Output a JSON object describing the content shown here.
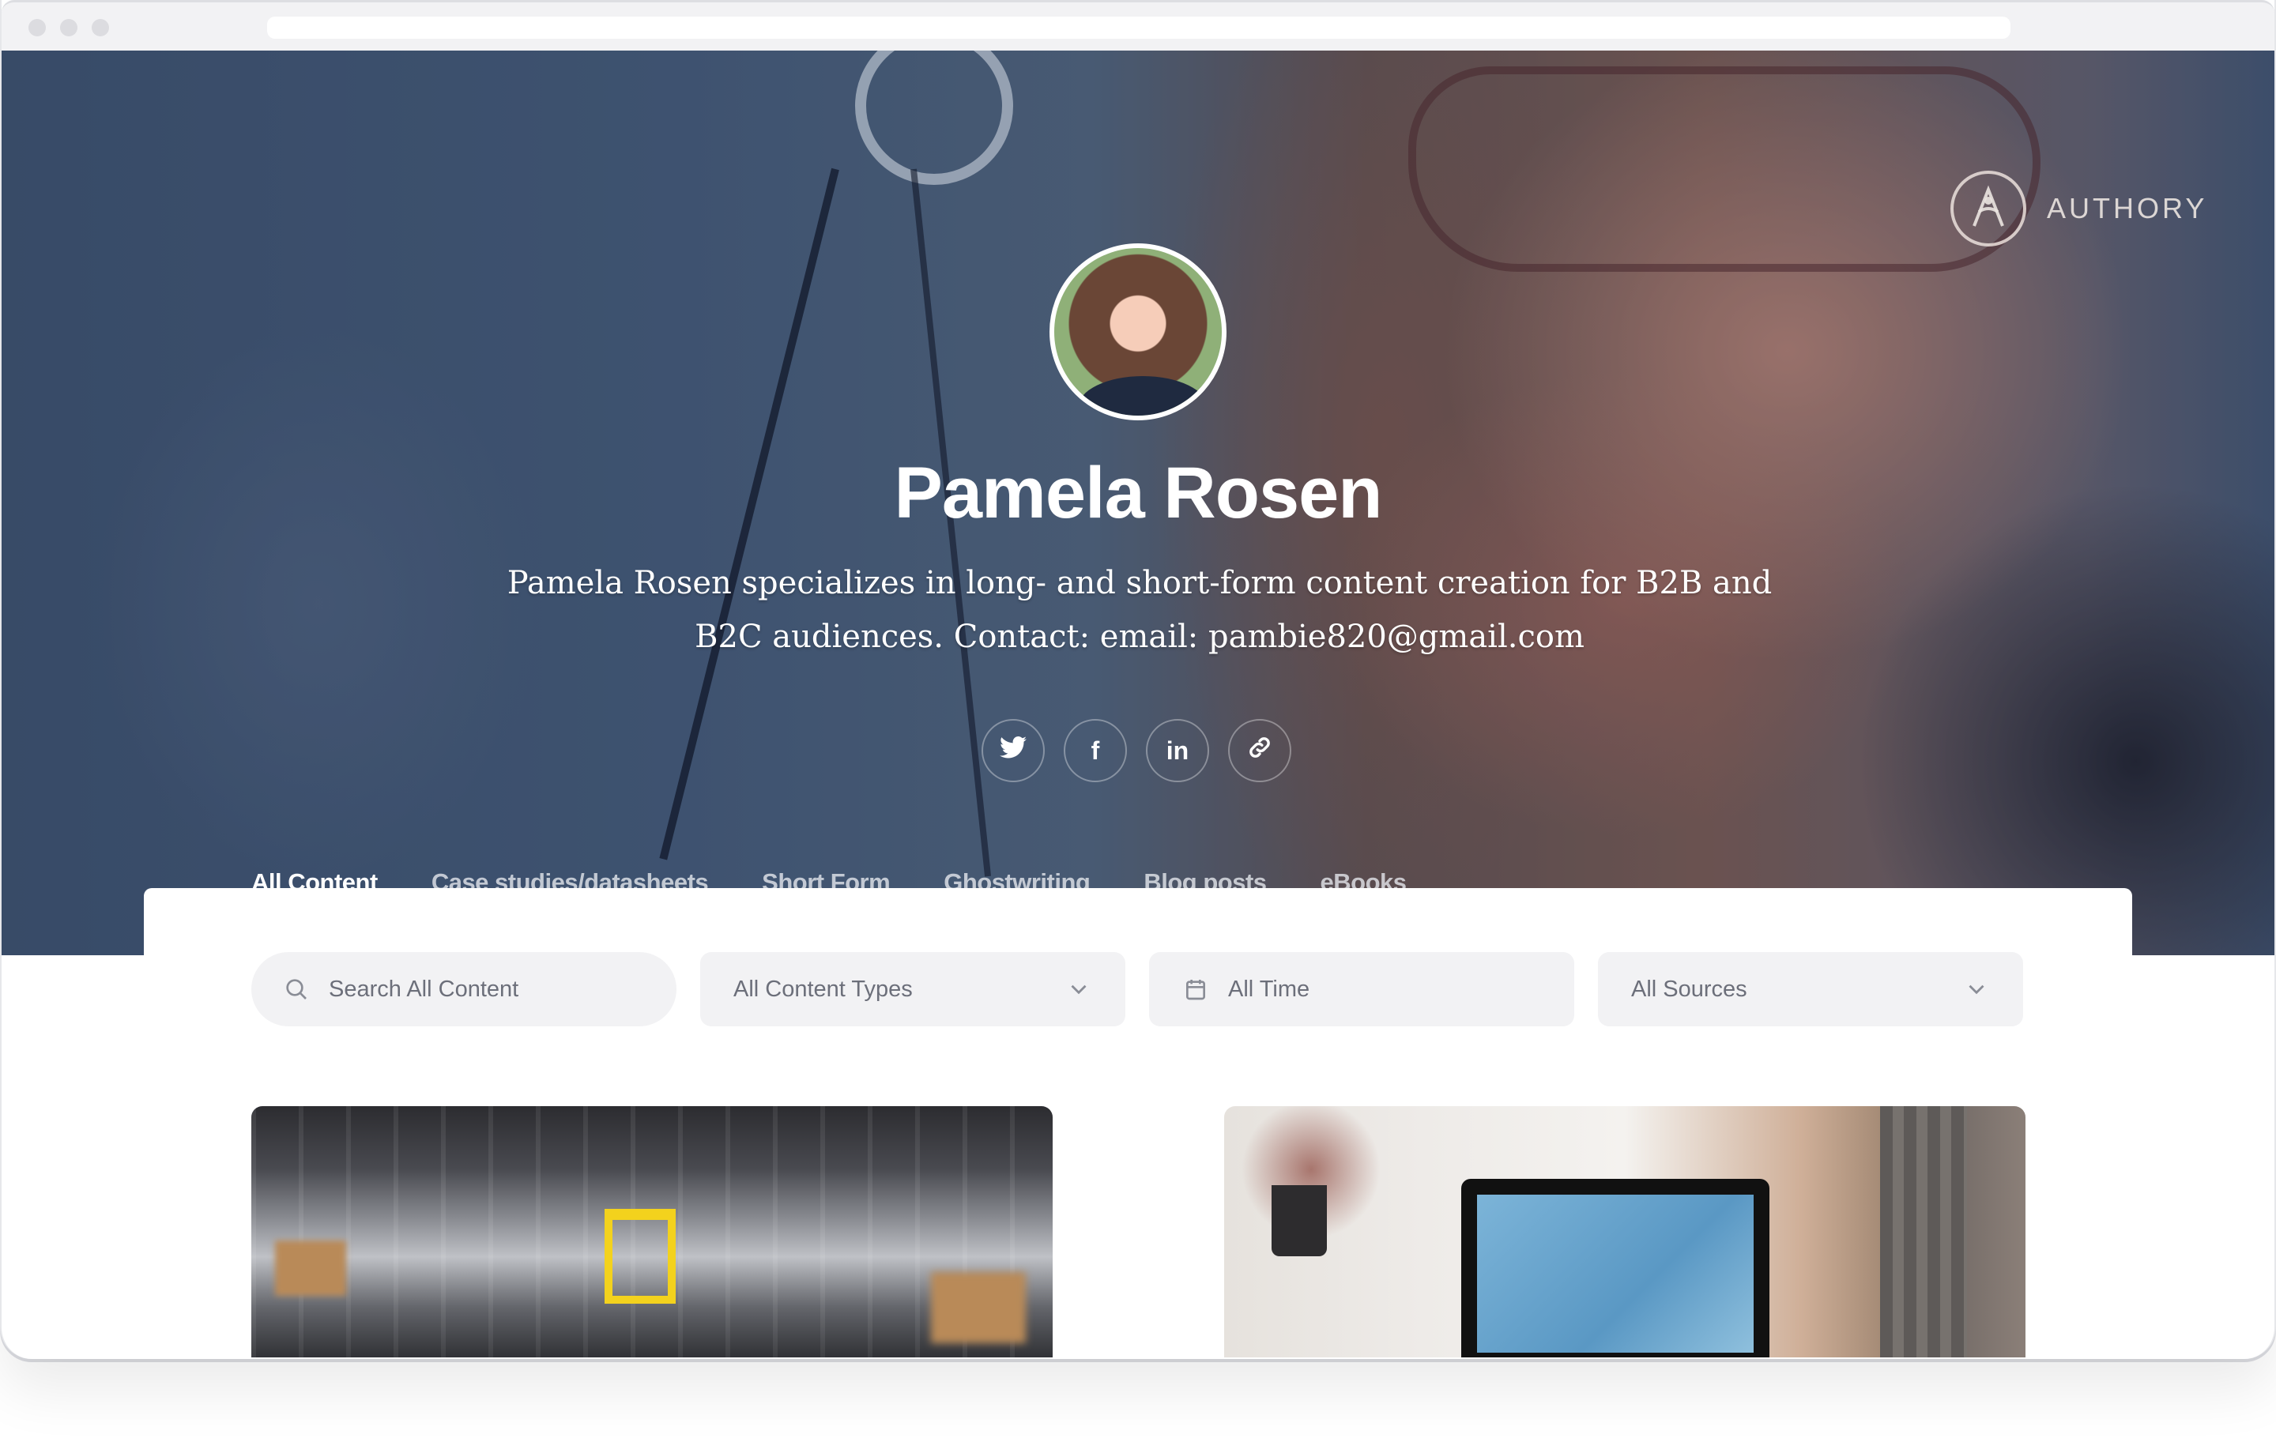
{
  "browser": {
    "url": ""
  },
  "brand": {
    "logo_text": "AUTHORY",
    "accent": "#3f74f6"
  },
  "profile": {
    "name": "Pamela Rosen",
    "bio": "Pamela Rosen specializes in long- and short-form content creation for B2B and B2C audiences. Contact: email: pambie820@gmail.com"
  },
  "socials": [
    {
      "name": "twitter",
      "icon": "twitter-icon"
    },
    {
      "name": "facebook",
      "icon": "facebook-icon",
      "glyph": "f"
    },
    {
      "name": "linkedin",
      "icon": "linkedin-icon",
      "glyph": "in"
    },
    {
      "name": "website",
      "icon": "link-icon"
    }
  ],
  "tabs": [
    {
      "label": "All Content",
      "active": true
    },
    {
      "label": "Case studies/datasheets",
      "active": false
    },
    {
      "label": "Short Form",
      "active": false
    },
    {
      "label": "Ghostwriting",
      "active": false
    },
    {
      "label": "Blog posts",
      "active": false
    },
    {
      "label": "eBooks",
      "active": false
    }
  ],
  "filters": {
    "search_placeholder": "Search All Content",
    "content_types": "All Content Types",
    "time": "All Time",
    "sources": "All Sources"
  },
  "content_cards": [
    {
      "image": "warehouse conveyor belts"
    },
    {
      "image": "laptop with charts on desk by window"
    }
  ]
}
